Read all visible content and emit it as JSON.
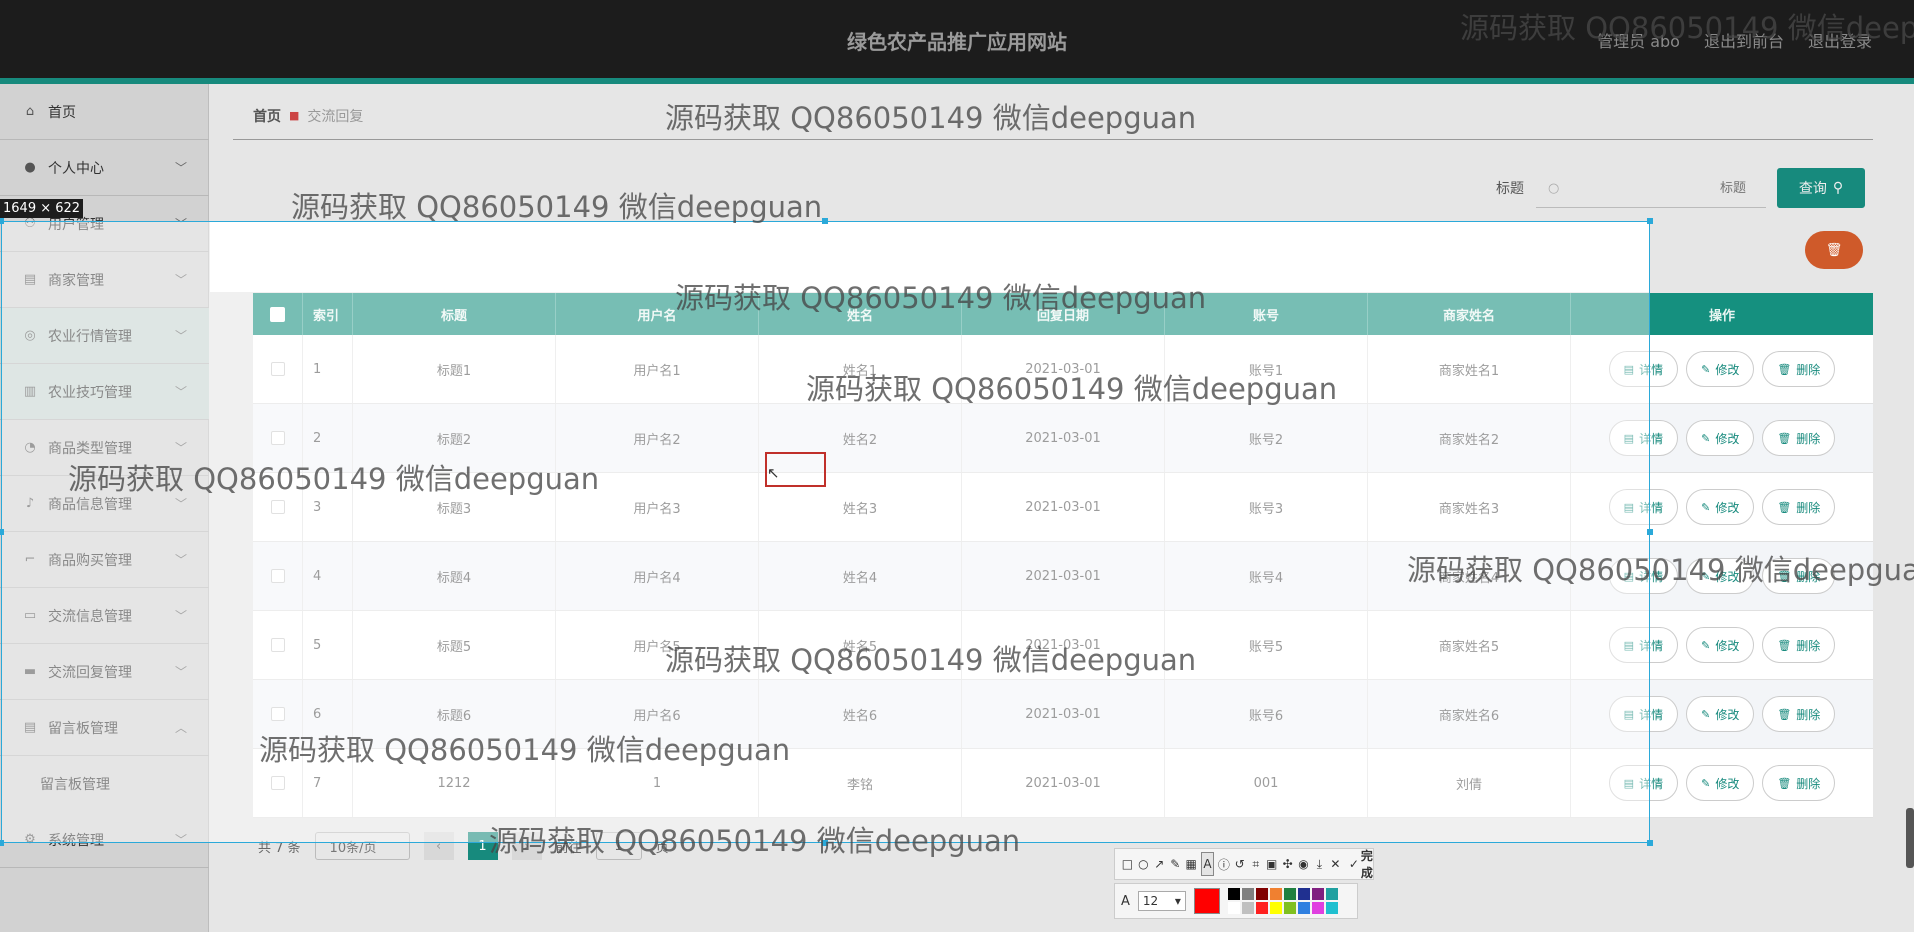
{
  "header": {
    "site_title": "绿色农产品推广应用网站",
    "user_link": "管理员 abo",
    "front_link": "退出到前台",
    "logout_link": "退出登录"
  },
  "sidebar": {
    "items": [
      {
        "label": "首页",
        "icon": "home-icon",
        "expandable": false
      },
      {
        "label": "个人中心",
        "icon": "user-icon",
        "expandable": true
      },
      {
        "label": "用户管理",
        "icon": "users-icon",
        "expandable": true
      },
      {
        "label": "商家管理",
        "icon": "clipboard-icon",
        "expandable": true
      },
      {
        "label": "农业行情管理",
        "icon": "compass-icon",
        "expandable": true
      },
      {
        "label": "农业技巧管理",
        "icon": "chart-icon",
        "expandable": true
      },
      {
        "label": "商品类型管理",
        "icon": "gauge-icon",
        "expandable": true
      },
      {
        "label": "商品信息管理",
        "icon": "mic-icon",
        "expandable": true
      },
      {
        "label": "商品购买管理",
        "icon": "crop-icon",
        "expandable": true
      },
      {
        "label": "交流信息管理",
        "icon": "chat-icon",
        "expandable": true
      },
      {
        "label": "交流回复管理",
        "icon": "monitor-icon",
        "expandable": true
      },
      {
        "label": "留言板管理",
        "icon": "clipboard-icon",
        "expandable": true,
        "expanded": true
      },
      {
        "label": "系统管理",
        "icon": "gear-icon",
        "expandable": true
      }
    ],
    "submenu": {
      "label": "留言板管理"
    }
  },
  "breadcrumb": {
    "home": "首页",
    "current": "交流回复"
  },
  "search": {
    "label": "标题",
    "placeholder": "标题",
    "button_label": "查询"
  },
  "table": {
    "headers": [
      "索引",
      "标题",
      "用户名",
      "姓名",
      "回复日期",
      "账号",
      "商家姓名",
      "操作"
    ],
    "rows": [
      [
        "1",
        "标题1",
        "用户名1",
        "姓名1",
        "2021-03-01",
        "账号1",
        "商家姓名1"
      ],
      [
        "2",
        "标题2",
        "用户名2",
        "姓名2",
        "2021-03-01",
        "账号2",
        "商家姓名2"
      ],
      [
        "3",
        "标题3",
        "用户名3",
        "姓名3",
        "2021-03-01",
        "账号3",
        "商家姓名3"
      ],
      [
        "4",
        "标题4",
        "用户名4",
        "姓名4",
        "2021-03-01",
        "账号4",
        "商家姓名4"
      ],
      [
        "5",
        "标题5",
        "用户名5",
        "姓名5",
        "2021-03-01",
        "账号5",
        "商家姓名5"
      ],
      [
        "6",
        "标题6",
        "用户名6",
        "姓名6",
        "2021-03-01",
        "账号6",
        "商家姓名6"
      ],
      [
        "7",
        "1212",
        "1",
        "李铭",
        "2021-03-01",
        "001",
        "刘倩"
      ]
    ],
    "actions": {
      "detail": "详情",
      "edit": "修改",
      "delete": "删除"
    }
  },
  "pagination": {
    "total": "共 7 条",
    "page_size": "10条/页",
    "current_page": "1",
    "goto_label": "前往",
    "goto_value": "1",
    "page_unit": "页"
  },
  "screenshot_tool": {
    "size_label": "1649 × 622",
    "done_label": "完成",
    "font_size": "12",
    "current_color": "#ff0000",
    "palette": [
      "#000000",
      "#808080",
      "#800000",
      "#f08030",
      "#208040",
      "#203090",
      "#802080",
      "#20a0a0",
      "#ffffff",
      "#c0c0c0",
      "#ff2020",
      "#ffff00",
      "#80c020",
      "#3080e0",
      "#e040e0",
      "#20c0d0"
    ]
  },
  "watermark": "源码获取 QQ86050149 微信deepguan"
}
